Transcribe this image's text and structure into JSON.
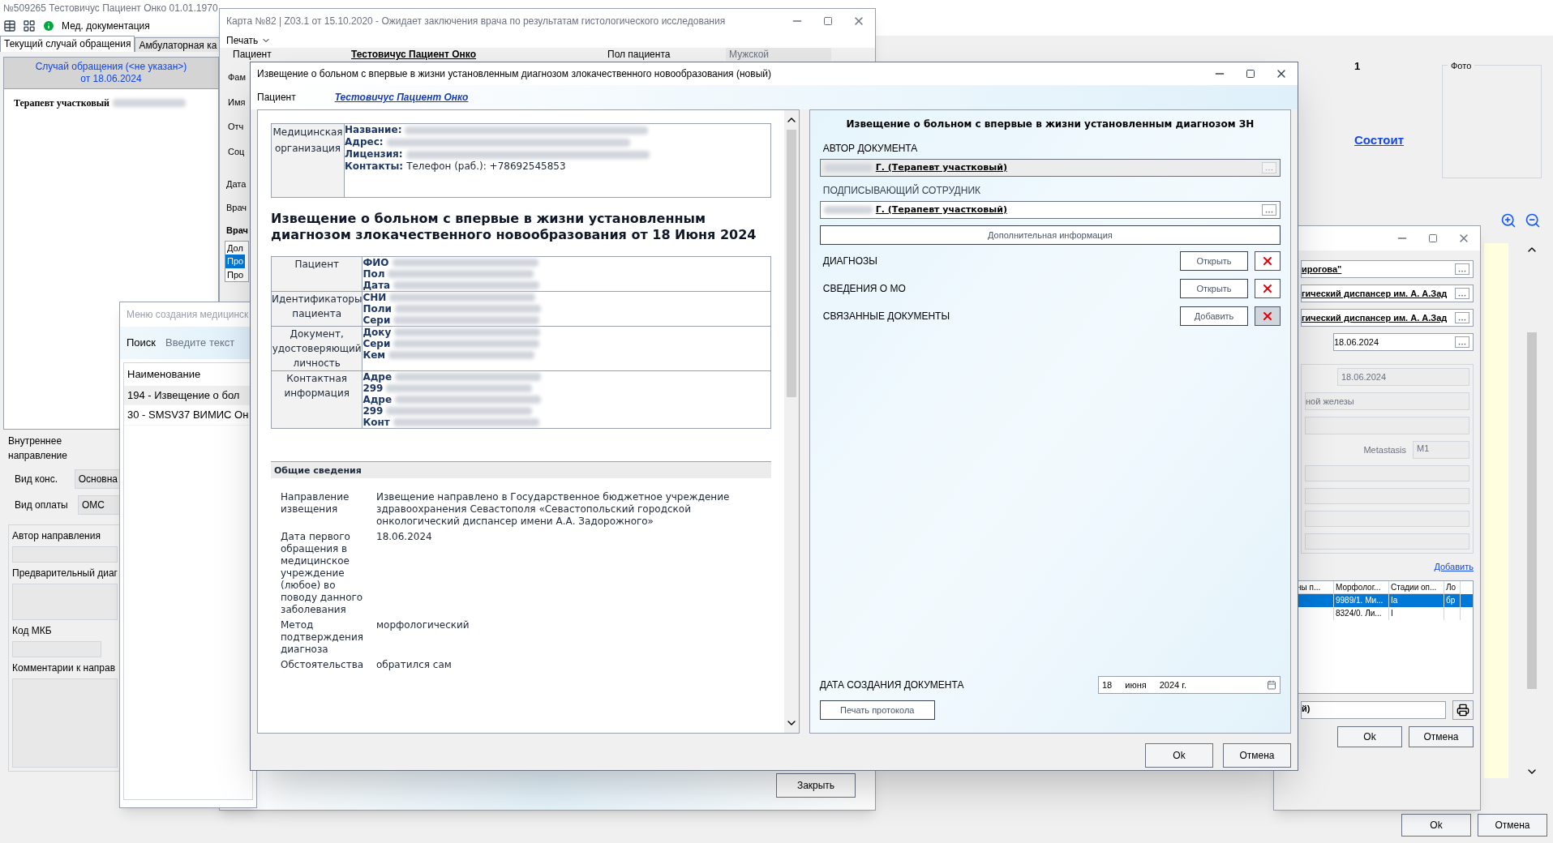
{
  "main_window": {
    "title": "№509265 Тестовичус Пациент Онко 01.01.1970",
    "toolbar_label": "Мед. документация",
    "tabs": [
      {
        "label": "Текущий случай обращения",
        "selected": true
      },
      {
        "label": "Амбулаторная ка",
        "selected": false
      }
    ],
    "case_header": [
      "Случай обращения (<не указан>)",
      "от 18.06.2024"
    ],
    "tree_item": "Терапевт участковый",
    "referral": {
      "title": "Внутреннее направление",
      "fields": [
        {
          "label": "Вид конс.",
          "value": "Основна"
        },
        {
          "label": "Вид оплаты",
          "value": "ОМС"
        }
      ],
      "author_label": "Автор направления",
      "diagnosis_label": "Предварительный диаг",
      "mkb_label": "Код МКБ",
      "comment_label": "Комментарии к направ"
    },
    "count": "1",
    "status_link": "Состоит",
    "photo_label": "Фото",
    "buttons": [
      "Ok",
      "Отмена"
    ]
  },
  "card_window": {
    "title": "Карта №82 | Z03.1 от 15.10.2020 - Ожидает заключения врача по результатам гистологического исследования",
    "menu": "Печать",
    "patient_label": "Пациент",
    "patient_value": "Тестовичус Пациент Онко",
    "sex_label": "Пол пациента",
    "sex_value": "Мужской",
    "side_labels": [
      "Фам",
      "Имя",
      "Отч",
      "Соц"
    ],
    "lower_labels": [
      "Дата",
      "Врач"
    ],
    "doctors_label": "Врач",
    "list": [
      {
        "text": "Дол",
        "selected": false
      },
      {
        "text": "Про",
        "selected": true
      },
      {
        "text": "Про",
        "selected": false
      }
    ],
    "close_button": "Закрыть"
  },
  "menu_window": {
    "title": "Меню создания медицинск",
    "search_label": "Поиск",
    "search_placeholder": "Введите текст",
    "column": "Наименование",
    "rows": [
      {
        "text": "194 - Извещение о бол",
        "selected": true
      },
      {
        "text": "30 - SMSV37 ВИМИС Он",
        "selected": false
      }
    ]
  },
  "notice_dialog": {
    "title": "Извещение о больном с впервые в жизни установленным диагнозом злокачественного новообразования (новый)",
    "patient_label": "Пациент",
    "patient_link": "Тестовичус Пациент Онко",
    "document": {
      "org_label": "Медицинская организация",
      "org_lines": [
        {
          "key": "Название:"
        },
        {
          "key": "Адрес:"
        },
        {
          "key": "Лицензия:"
        },
        {
          "key": "Контакты:",
          "value": "Телефон (раб.): +78692545853"
        }
      ],
      "heading": "Извещение о больном с впервые в жизни установленным диагнозом злокачественного новообразования от 18 Июня 2024",
      "patient_rows": [
        {
          "label": "Пациент",
          "lines": [
            "ФИО",
            "Пол",
            "Дата"
          ]
        },
        {
          "label": "Идентификаторы пациента",
          "lines": [
            "СНИ",
            "Поли",
            "Сери"
          ]
        },
        {
          "label": "Документ, удостоверяющий личность",
          "lines": [
            "Доку",
            "Сери",
            "Кем"
          ]
        },
        {
          "label": "Контактная информация",
          "lines": [
            "Адре",
            "299",
            "Адре",
            "299",
            "Конт"
          ]
        }
      ],
      "section": "Общие сведения",
      "general_rows": [
        {
          "label": "Направление извещения",
          "value": "Извещение направлено в Государственное бюджетное учреждение здравоохранения Севастополя «Севастопольский городской онкологический диспансер имени А.А. Задорожного»"
        },
        {
          "label": "Дата первого обращения в медицинское учреждение (любое) во поводу данного заболевания",
          "value": "18.06.2024"
        },
        {
          "label": "Метод подтверждения диагноза",
          "value": "морфологический"
        },
        {
          "label": "Обстоятельства",
          "value": "обратился сам"
        }
      ]
    },
    "panel": {
      "title": "Извещение о больном с впервые в жизни установленным диагнозом ЗН",
      "people": [
        {
          "label": "АВТОР ДОКУМЕНТА",
          "value": "Г. (Терапевт участковый)",
          "disabled": true
        },
        {
          "label": "ПОДПИСЫВАЮЩИЙ СОТРУДНИК",
          "value": "Г. (Терапевт участковый)",
          "disabled": false
        }
      ],
      "extra_button": "Дополнительная информация",
      "sections": [
        {
          "label": "ДИАГНОЗЫ",
          "action": "Открыть"
        },
        {
          "label": "СВЕДЕНИЯ О МО",
          "action": "Открыть"
        },
        {
          "label": "СВЯЗАННЫЕ ДОКУМЕНТЫ",
          "action": "Добавить"
        }
      ],
      "date_label": "ДАТА СОЗДАНИЯ ДОКУМЕНТА",
      "date_parts": [
        "18",
        "июня",
        "2024 г."
      ],
      "print_button": "Печать протокола"
    },
    "buttons": [
      "Ok",
      "Отмена"
    ]
  },
  "diagnosis_window": {
    "fields": [
      {
        "value": "ирогова\"",
        "kind": "link"
      },
      {
        "value": "гический диспансер им. А. А.Зад",
        "kind": "link"
      },
      {
        "value": "гический диспансер им. А. А.Зад",
        "kind": "link"
      },
      {
        "value": "18.06.2024",
        "kind": "date"
      }
    ],
    "stage_date": "18.06.2024",
    "organ": "ной железы",
    "metastasis_label": "Metastasis",
    "metastasis_value": "M1",
    "add_link": "Добавить",
    "columns": [
      "ны п...",
      "Морфолог...",
      "Стадии оп...",
      "Ло"
    ],
    "rows": [
      {
        "cells": [
          "",
          "9989/1. Ми...",
          "Ia",
          "бр"
        ],
        "selected": true
      },
      {
        "cells": [
          "",
          "8324/0. Ли...",
          "I",
          ""
        ],
        "selected": false
      }
    ],
    "bottom_field": "й)",
    "buttons": [
      "Ok",
      "Отмена"
    ]
  }
}
